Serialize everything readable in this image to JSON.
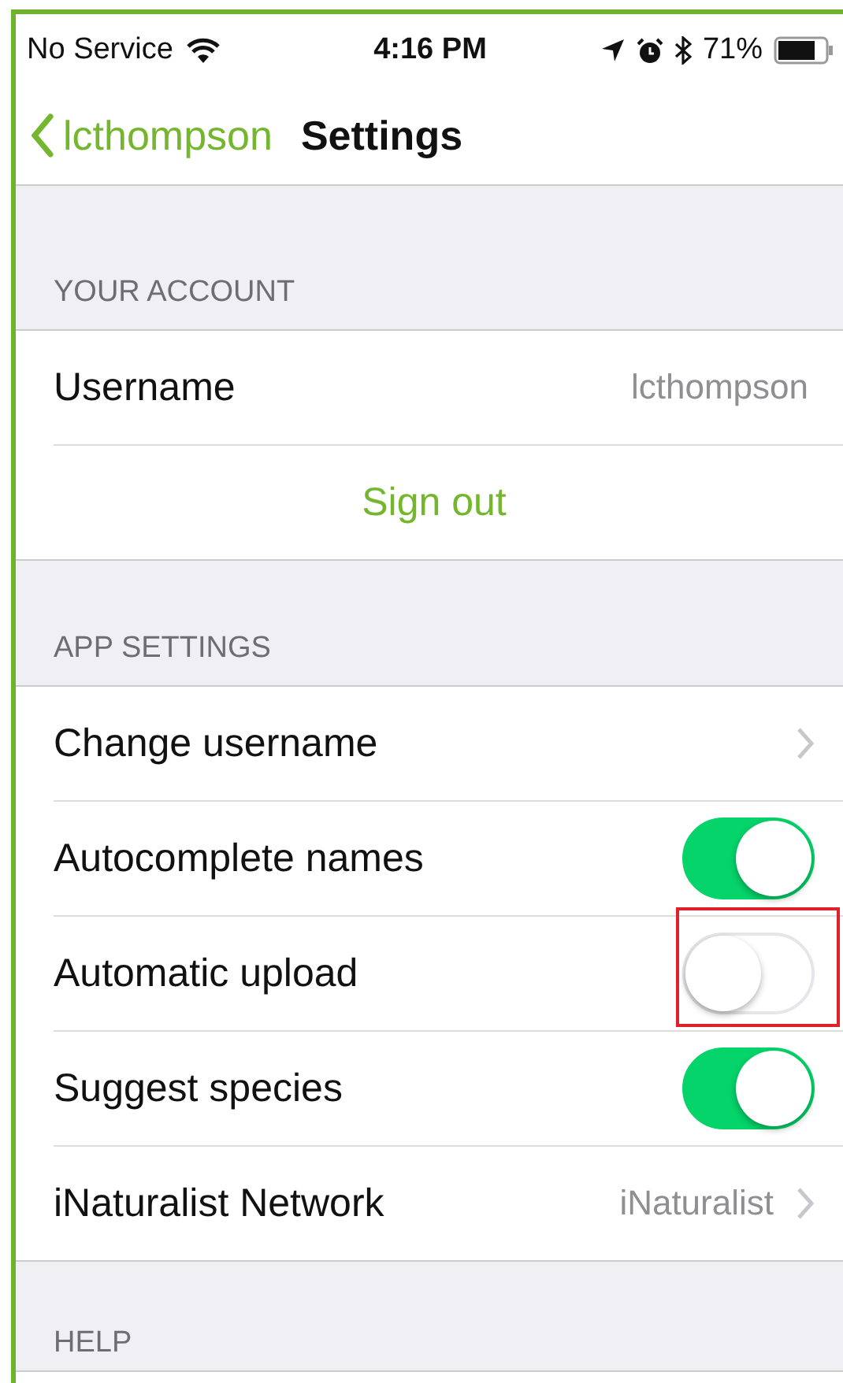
{
  "status_bar": {
    "carrier": "No Service",
    "time": "4:16 PM",
    "battery": "71%"
  },
  "nav": {
    "back": "lcthompson",
    "title": "Settings"
  },
  "sections": [
    {
      "header": "YOUR ACCOUNT",
      "rows": [
        {
          "kind": "value",
          "label": "Username",
          "value": "lcthompson"
        },
        {
          "kind": "action",
          "label": "Sign out"
        }
      ]
    },
    {
      "header": "APP SETTINGS",
      "rows": [
        {
          "kind": "disclosure",
          "label": "Change username"
        },
        {
          "kind": "toggle",
          "label": "Autocomplete names",
          "on": true,
          "highlighted": false
        },
        {
          "kind": "toggle",
          "label": "Automatic upload",
          "on": false,
          "highlighted": true
        },
        {
          "kind": "toggle",
          "label": "Suggest species",
          "on": true,
          "highlighted": false
        },
        {
          "kind": "disclosure",
          "label": "iNaturalist Network",
          "value": "iNaturalist"
        }
      ]
    },
    {
      "header": "HELP"
    }
  ]
}
